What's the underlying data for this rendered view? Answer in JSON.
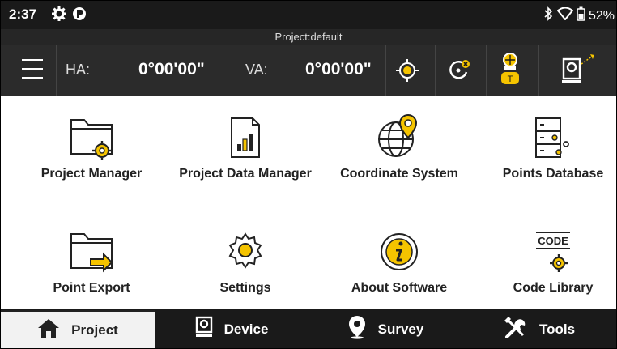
{
  "status": {
    "time": "2:37",
    "battery": "52%"
  },
  "project": {
    "title": "Project:default"
  },
  "toolbar": {
    "ha_label": "HA:",
    "ha_value": "0°00'00\"",
    "va_label": "VA:",
    "va_value": "0°00'00\"",
    "target_badge": "T"
  },
  "tiles": [
    {
      "label": "Project Manager",
      "icon": "folder-gear-icon"
    },
    {
      "label": "Project Data Manager",
      "icon": "data-chart-icon"
    },
    {
      "label": "Coordinate System",
      "icon": "globe-pin-icon"
    },
    {
      "label": "Points Database",
      "icon": "points-database-icon"
    },
    {
      "label": "Point Export",
      "icon": "folder-export-icon"
    },
    {
      "label": "Settings",
      "icon": "settings-gear-icon"
    },
    {
      "label": "About Software",
      "icon": "info-icon"
    },
    {
      "label": "Code Library",
      "icon": "code-library-icon",
      "badge": "CODE"
    }
  ],
  "nav": [
    {
      "label": "Project",
      "icon": "home-icon",
      "active": true
    },
    {
      "label": "Device",
      "icon": "total-station-icon"
    },
    {
      "label": "Survey",
      "icon": "location-pin-icon"
    },
    {
      "label": "Tools",
      "icon": "tools-icon"
    }
  ],
  "colors": {
    "accent": "#f5c400",
    "dark": "#1a1a1a",
    "toolbar": "#2b2b2b"
  }
}
